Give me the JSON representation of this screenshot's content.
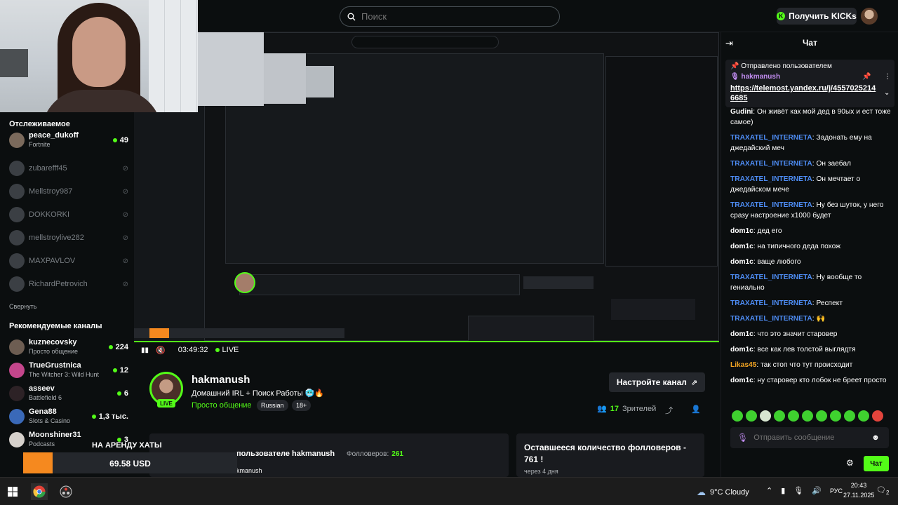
{
  "header": {
    "search_placeholder": "Поиск",
    "kicks_button": "Получить KICKs"
  },
  "sidebar": {
    "following_title": "Отслеживаемое",
    "following": [
      {
        "name": "peace_dukoff",
        "sub": "Fortnite",
        "count": "49",
        "live": true
      },
      {
        "name": "zubarefff45",
        "sub": "",
        "count": "",
        "live": false
      },
      {
        "name": "Mellstroy987",
        "sub": "",
        "count": "",
        "live": false
      },
      {
        "name": "DOKKORKI",
        "sub": "",
        "count": "",
        "live": false
      },
      {
        "name": "mellstroylive282",
        "sub": "",
        "count": "",
        "live": false
      },
      {
        "name": "MAXPAVLOV",
        "sub": "",
        "count": "",
        "live": false
      },
      {
        "name": "RichardPetrovich",
        "sub": "",
        "count": "",
        "live": false
      }
    ],
    "collapse_label": "Свернуть",
    "recommended_title": "Рекомендуемые каналы",
    "recommended": [
      {
        "name": "kuznecovsky",
        "sub": "Просто общение",
        "count": "224"
      },
      {
        "name": "TrueGrustnica",
        "sub": "The Witcher 3: Wild Hunt",
        "count": "12"
      },
      {
        "name": "asseev",
        "sub": "Battlefield 6",
        "count": "6"
      },
      {
        "name": "Gena88",
        "sub": "Slots & Casino",
        "count": "1,3 тыс."
      },
      {
        "name": "Moonshiner31",
        "sub": "Podcasts",
        "count": "3"
      }
    ]
  },
  "player": {
    "time": "03:49:32",
    "live_label": "LIVE"
  },
  "channel": {
    "name": "hakmanush",
    "live_badge": "LIVE",
    "title": "Домашний IRL + Поиск Работы 🥶🔥",
    "category": "Просто общение",
    "tags": [
      "Russian",
      "18+"
    ],
    "setup_button": "Настройте канал",
    "viewers_count": "17",
    "viewers_label": "Зрителей"
  },
  "about": {
    "title": "пользователе hakmanush",
    "followers_label": "Фолловеров:",
    "followers_value": "261",
    "sub": "kmanush"
  },
  "goal": {
    "title": "Оставшееся количество фолловеров - 761 !",
    "ends": "через 4 дня"
  },
  "donation": {
    "label": "НА АРЕНДУ ХАТЫ",
    "amount": "69.58 USD",
    "min": "0",
    "max": "500",
    "progress_fraction": 0.139
  },
  "chat": {
    "title": "Чат",
    "pinned_header": "Отправлено пользователем",
    "pinned_user": "hakmanush",
    "pinned_link": "https://telemost.yandex.ru/j/45570252146685",
    "messages": [
      {
        "user": "Gudini",
        "color": "#ffffff",
        "text": "Он живёт как мой дед в 90ых и ест тоже самое)"
      },
      {
        "user": "TRAXATEL_INTERNETA",
        "color": "#4e8df5",
        "text": "Задонать ему на джедайский меч"
      },
      {
        "user": "TRAXATEL_INTERNETA",
        "color": "#4e8df5",
        "text": "Он заебал"
      },
      {
        "user": "TRAXATEL_INTERNETA",
        "color": "#4e8df5",
        "text": "Он мечтает о джедайском мече"
      },
      {
        "user": "TRAXATEL_INTERNETA",
        "color": "#4e8df5",
        "text": "Ну без шуток, у него сразу настроение х1000 будет"
      },
      {
        "user": "dom1c",
        "color": "#ffffff",
        "text": "дед его"
      },
      {
        "user": "dom1c",
        "color": "#ffffff",
        "text": "на типичного деда похож"
      },
      {
        "user": "dom1c",
        "color": "#ffffff",
        "text": "ваще любого"
      },
      {
        "user": "TRAXATEL_INTERNETA",
        "color": "#4e8df5",
        "text": "Ну вообще то гениально"
      },
      {
        "user": "TRAXATEL_INTERNETA",
        "color": "#4e8df5",
        "text": "Респект"
      },
      {
        "user": "TRAXATEL_INTERNETA",
        "color": "#4e8df5",
        "text": "🙌"
      },
      {
        "user": "dom1c",
        "color": "#ffffff",
        "text": "что это значит старовер"
      },
      {
        "user": "dom1c",
        "color": "#ffffff",
        "text": "все как лев толстой выглядтя"
      },
      {
        "user": "Likas45",
        "color": "#f5a623",
        "text": "так стоп что тут происходит"
      },
      {
        "user": "dom1c",
        "color": "#ffffff",
        "text": "ну старовер кто лобок не бреет просто"
      }
    ],
    "input_placeholder": "Отправить сообщение",
    "send_button": "Чат"
  },
  "taskbar": {
    "weather": "9°C Cloudy",
    "lang": "РУС",
    "time": "20:43",
    "date": "27.11.2025",
    "notifications": "2"
  },
  "colors": {
    "accent": "#53fc18",
    "background": "#0b0e0f",
    "panel": "#191b1f",
    "username_blue": "#4e8df5",
    "username_orange": "#f5a623"
  }
}
